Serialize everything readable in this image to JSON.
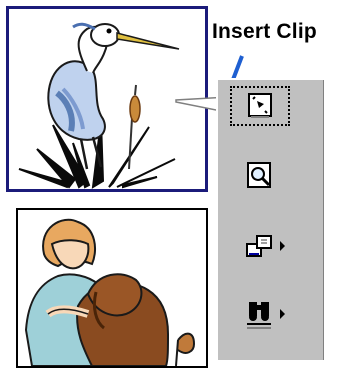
{
  "callout": {
    "label": "Insert Clip"
  },
  "clips": [
    {
      "name": "heron"
    },
    {
      "name": "person-with-dog"
    }
  ],
  "toolbar": {
    "buttons": [
      {
        "name": "insert-clip",
        "icon": "insert-clip-icon",
        "has_dropdown": false
      },
      {
        "name": "preview-clip",
        "icon": "magnifier-icon",
        "has_dropdown": false
      },
      {
        "name": "add-to-category",
        "icon": "add-category-icon",
        "has_dropdown": true
      },
      {
        "name": "find-similar",
        "icon": "binoculars-icon",
        "has_dropdown": true
      }
    ]
  },
  "colors": {
    "frame": "#1b1b7a",
    "callout_line": "#1e5fd1",
    "panel": "#c0c0c0"
  }
}
